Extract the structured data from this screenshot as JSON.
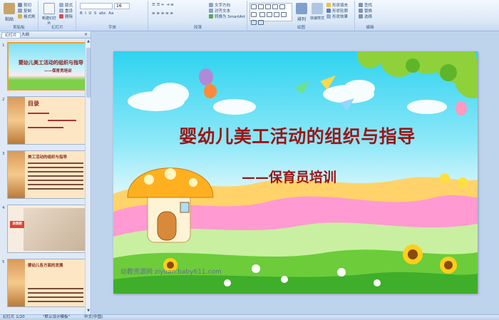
{
  "ribbon": {
    "clipboard": {
      "group_label": "剪贴板",
      "paste": "粘贴",
      "cut": "剪切",
      "copy": "复制",
      "format_painter": "格式刷"
    },
    "slides": {
      "group_label": "幻灯片",
      "new_slide": "新建幻灯片",
      "layout": "版式",
      "reset": "重设",
      "delete": "删除"
    },
    "font": {
      "group_label": "字体",
      "font_size": "16"
    },
    "paragraph": {
      "group_label": "段落",
      "text_direction": "文字方向",
      "align_text": "对齐文本",
      "smartart": "转换为 SmartArt"
    },
    "drawing": {
      "group_label": "绘图",
      "arrange": "排列",
      "quick_styles": "快速样式",
      "shape_fill": "形状填充",
      "shape_outline": "形状轮廓",
      "shape_effects": "形状效果"
    },
    "editing": {
      "group_label": "编辑",
      "find": "查找",
      "replace": "替换",
      "select": "选择"
    }
  },
  "pane": {
    "tabs": [
      "幻灯片",
      "大纲"
    ],
    "close": "×",
    "thumbnails": [
      {
        "num": "1",
        "title": "婴幼儿美工活动的组织与指导",
        "subtitle": "——保育员培训"
      },
      {
        "num": "2",
        "heading": "目录"
      },
      {
        "num": "3",
        "heading": "美工活动的组织与指导"
      },
      {
        "num": "4",
        "stamp": "涂鸦期"
      },
      {
        "num": "5",
        "heading": "婴幼儿各方面的发展"
      }
    ]
  },
  "slide": {
    "title": "婴幼儿美工活动的组织与指导",
    "subtitle": "——保育员培训",
    "watermark": "幼教资源网 ziyuan.baby611.com"
  },
  "statusbar": {
    "slide_info": "幻灯片 1/20",
    "theme": "\"默认设计模板\"",
    "language": "中文(中国)"
  }
}
